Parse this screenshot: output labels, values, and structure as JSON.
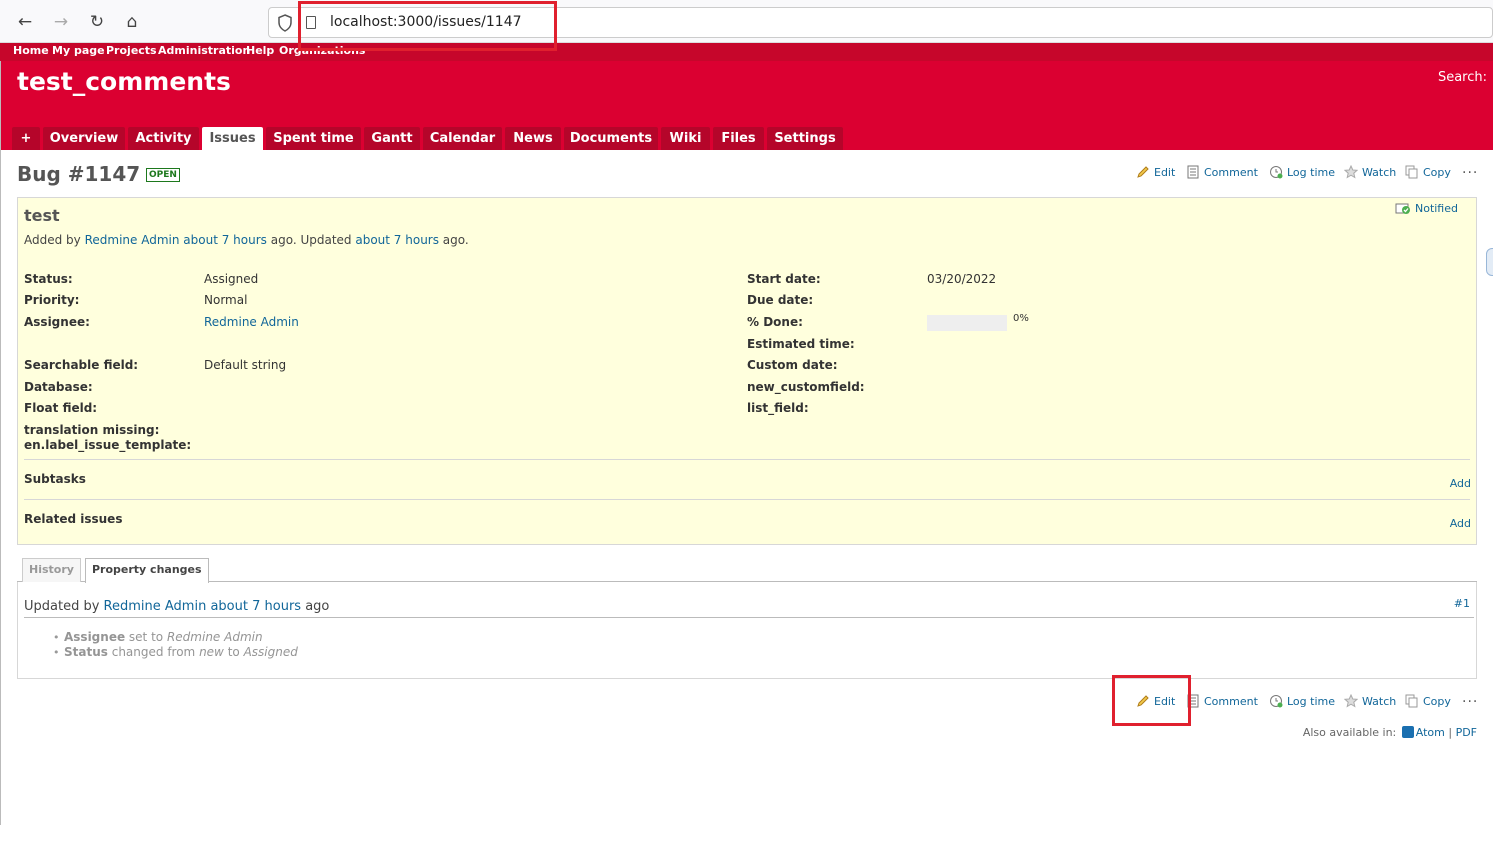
{
  "browser": {
    "url": "localhost:3000/issues/1147",
    "back_icon": "←",
    "forward_icon": "→",
    "reload_icon": "↻",
    "home_icon": "⌂"
  },
  "top_menu": {
    "items": [
      "Home",
      "My page",
      "Projects",
      "Administration",
      "Help",
      "Organizations"
    ]
  },
  "header": {
    "project_title": "test_comments",
    "search_label": "Search:"
  },
  "main_menu": {
    "tabs": [
      "+",
      "Overview",
      "Activity",
      "Issues",
      "Spent time",
      "Gantt",
      "Calendar",
      "News",
      "Documents",
      "Wiki",
      "Files",
      "Settings"
    ],
    "selected": "Issues"
  },
  "issue": {
    "heading": "Bug #1147",
    "status_badge": "OPEN",
    "subject": "test",
    "author_prefix": "Added by ",
    "author": "Redmine Admin",
    "added_ago": "about 7 hours",
    "updated_prefix": " ago. Updated ",
    "updated_ago": "about 7 hours",
    "updated_suffix": " ago.",
    "notified": "Notified"
  },
  "contextual": {
    "edit": "Edit",
    "comment": "Comment",
    "log_time": "Log time",
    "watch": "Watch",
    "copy": "Copy",
    "more": "..."
  },
  "attributes": {
    "left": [
      {
        "label": "Status:",
        "value": "Assigned"
      },
      {
        "label": "Priority:",
        "value": "Normal"
      },
      {
        "label": "Assignee:",
        "value": "Redmine Admin"
      },
      {
        "label": "Searchable field:",
        "value": "Default string"
      },
      {
        "label": "Database:",
        "value": ""
      },
      {
        "label": "Float field:",
        "value": ""
      },
      {
        "label": "translation missing:",
        "value": ""
      },
      {
        "label": "en.label_issue_template:",
        "value": ""
      }
    ],
    "right": [
      {
        "label": "Start date:",
        "value": "03/20/2022"
      },
      {
        "label": "Due date:",
        "value": ""
      },
      {
        "label": "% Done:",
        "value": "0%"
      },
      {
        "label": "Estimated time:",
        "value": ""
      },
      {
        "label": "Custom date:",
        "value": ""
      },
      {
        "label": "new_customfield:",
        "value": ""
      },
      {
        "label": "list_field:",
        "value": ""
      }
    ],
    "done_percent": 0
  },
  "sections": {
    "subtasks": "Subtasks",
    "related": "Related issues",
    "add": "Add"
  },
  "history_tabs": {
    "history": "History",
    "property_changes": "Property changes"
  },
  "journal": {
    "updated_by": "Updated by ",
    "author": "Redmine Admin",
    "ago": "about 7 hours",
    "ago_suffix": " ago",
    "number": "#1",
    "details": [
      {
        "field": "Assignee",
        "text": " set to ",
        "value": "Redmine Admin"
      },
      {
        "field": "Status",
        "text": " changed from ",
        "old": "new",
        "to": " to ",
        "value": "Assigned"
      }
    ]
  },
  "footer": {
    "also_available": "Also available in:",
    "atom": "Atom",
    "separator": "|",
    "pdf": "PDF"
  },
  "colors": {
    "header_bg": "#db0031",
    "top_menu_bg": "#c6062b",
    "issue_bg": "#ffffdd",
    "link": "#169",
    "highlight": "#e0202e"
  }
}
